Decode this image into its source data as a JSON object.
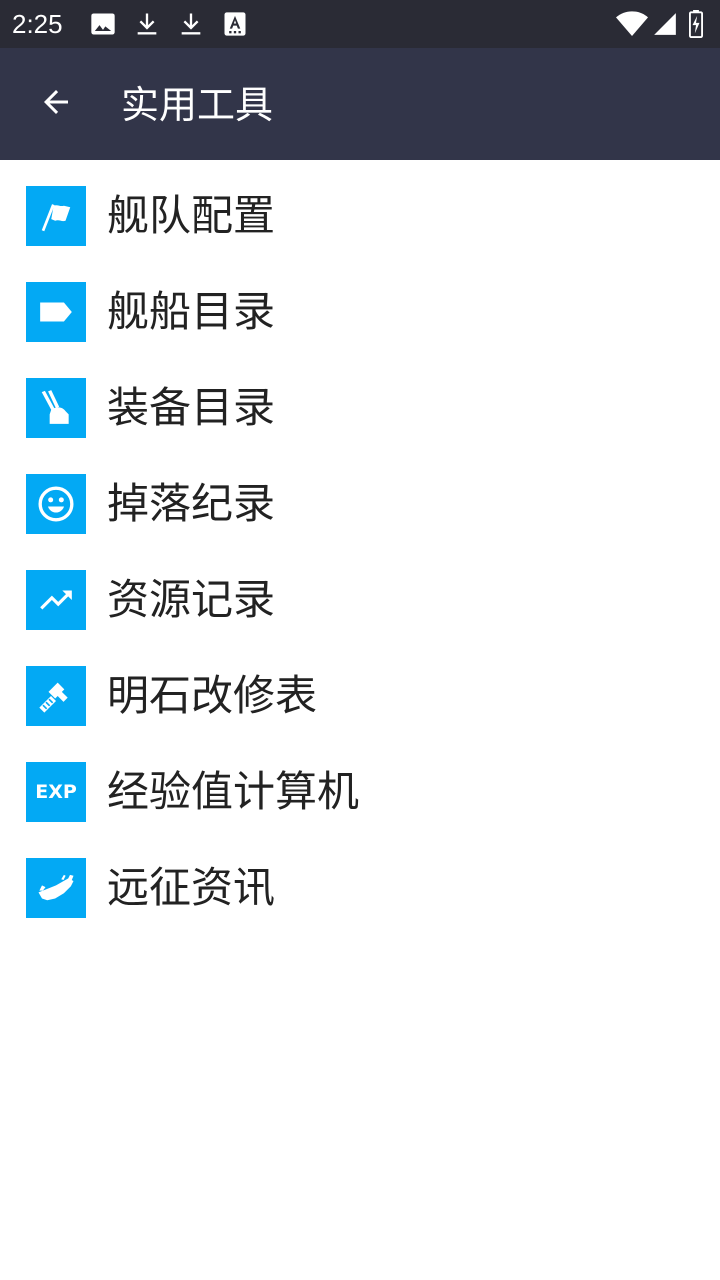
{
  "status_bar": {
    "time": "2:25",
    "left_icons": [
      "image-icon",
      "download-icon",
      "download-icon",
      "font-download-icon"
    ],
    "right_icons": [
      "wifi-icon",
      "cell-signal-icon",
      "battery-charging-icon"
    ]
  },
  "app_bar": {
    "title": "实用工具",
    "back_icon": "arrow-back-icon"
  },
  "colors": {
    "status_bar_bg": "#2a2b35",
    "app_bar_bg": "#323549",
    "icon_tile_bg": "#03a9f4",
    "text": "#222222"
  },
  "menu": {
    "items": [
      {
        "label": "舰队配置",
        "icon": "flag-icon"
      },
      {
        "label": "舰船目录",
        "icon": "label-tag-icon"
      },
      {
        "label": "装备目录",
        "icon": "brush-icon"
      },
      {
        "label": "掉落纪录",
        "icon": "smiley-face-icon"
      },
      {
        "label": "资源记录",
        "icon": "trending-up-icon"
      },
      {
        "label": "明石改修表",
        "icon": "wrench-icon"
      },
      {
        "label": "经验值计算机",
        "icon": "exp-icon",
        "icon_text": "EXP"
      },
      {
        "label": "远征资讯",
        "icon": "ship-icon"
      }
    ]
  }
}
